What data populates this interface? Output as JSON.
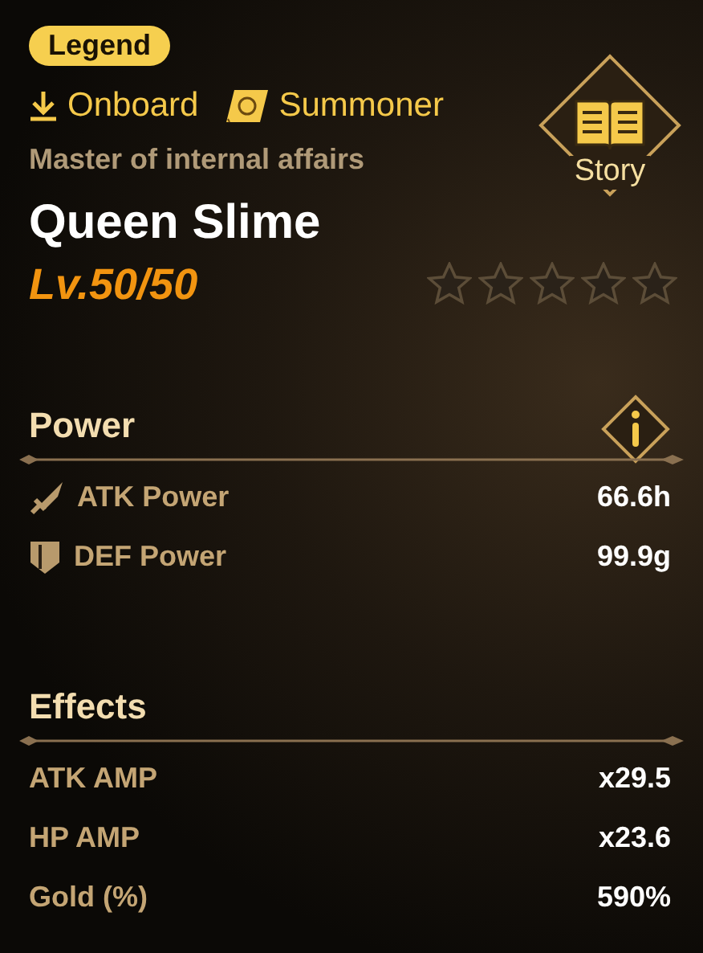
{
  "badge": "Legend",
  "links": [
    {
      "kind": "download",
      "label": "Onboard"
    },
    {
      "kind": "book",
      "label": "Summoner"
    }
  ],
  "story": {
    "label": "Story"
  },
  "subtitle": "Master of internal affairs",
  "name": "Queen Slime",
  "level_text": "Lv.50/50",
  "stars": 0,
  "sections": [
    {
      "title": "Power",
      "info": true,
      "rows": [
        {
          "kind": "attack",
          "label": "ATK Power",
          "value": "66.6h"
        },
        {
          "kind": "defense",
          "label": "DEF Power",
          "value": "99.9g"
        }
      ]
    },
    {
      "title": "Effects",
      "info": false,
      "rows": [
        {
          "kind": "plain",
          "label": "ATK AMP",
          "value": "x29.5"
        },
        {
          "kind": "plain",
          "label": "HP AMP",
          "value": "x23.6"
        },
        {
          "kind": "plain",
          "label": "Gold (%)",
          "value": "590%"
        }
      ]
    }
  ]
}
